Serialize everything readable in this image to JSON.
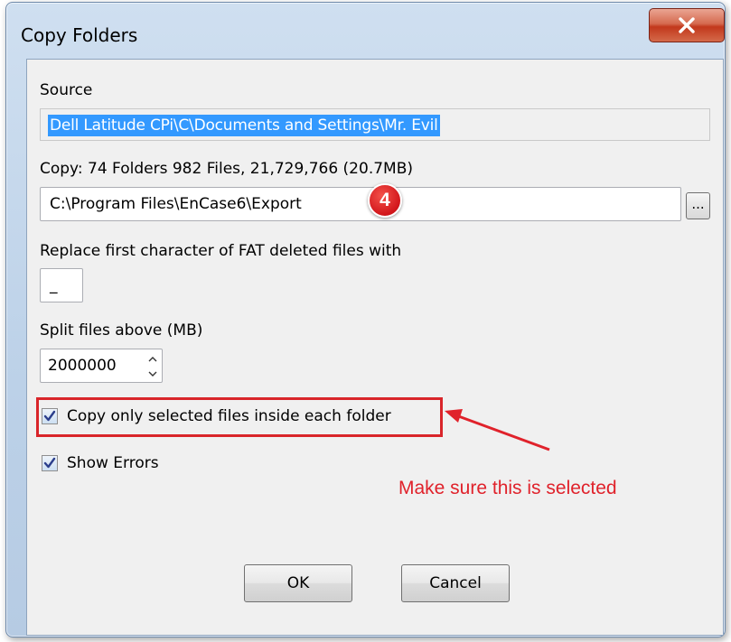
{
  "window": {
    "title": "Copy Folders",
    "close_label": "x"
  },
  "source": {
    "label": "Source",
    "value": "Dell Latitude CPi\\C\\Documents and Settings\\Mr. Evil"
  },
  "copy": {
    "summary": "Copy: 74 Folders 982 Files, 21,729,766 (20.7MB)",
    "destination_value": "C:\\Program Files\\EnCase6\\Export",
    "browse_label": "..."
  },
  "replace_char": {
    "label": "Replace first character of FAT deleted files with",
    "value": "_"
  },
  "split": {
    "label": "Split files above (MB)",
    "value": "2000000"
  },
  "options": {
    "copy_only_selected_label": "Copy only selected files inside each folder",
    "copy_only_selected_checked": true,
    "show_errors_label": "Show Errors",
    "show_errors_checked": true
  },
  "annotation": {
    "step_number": "4",
    "note": "Make sure this is selected",
    "color": "#e0222b"
  },
  "buttons": {
    "ok_label": "OK",
    "cancel_label": "Cancel"
  }
}
